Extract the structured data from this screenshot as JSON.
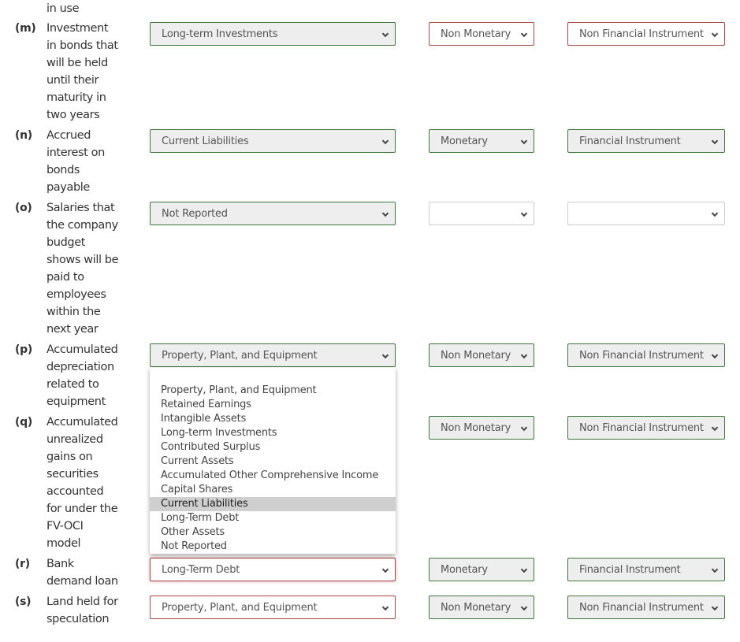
{
  "top_fragment": "in use",
  "rows": [
    {
      "letter": "(m)",
      "lines": [
        "Investment",
        "in bonds that",
        "will be held",
        "until their",
        "maturity in",
        "two years"
      ],
      "category": "Long-term Investments",
      "category_state": "correct",
      "monetary": "Non Monetary",
      "monetary_state": "incorrect",
      "financial": "Non Financial Instrument",
      "financial_state": "incorrect"
    },
    {
      "letter": "(n)",
      "lines": [
        "Accrued",
        "interest on",
        "bonds",
        "payable"
      ],
      "category": "Current Liabilities",
      "category_state": "correct",
      "monetary": "Monetary",
      "monetary_state": "correct",
      "financial": "Financial Instrument",
      "financial_state": "correct"
    },
    {
      "letter": "(o)",
      "lines": [
        "Salaries that",
        "the company",
        "budget",
        "shows will be",
        "paid to",
        "employees",
        "within the",
        "next year"
      ],
      "category": "Not Reported",
      "category_state": "correct",
      "monetary": "",
      "monetary_state": "blank",
      "financial": "",
      "financial_state": "blank"
    },
    {
      "letter": "(p)",
      "lines": [
        "Accumulated",
        "depreciation",
        "related to",
        "equipment"
      ],
      "category": "Property, Plant, and Equipment",
      "category_state": "correct",
      "monetary": "Non Monetary",
      "monetary_state": "correct",
      "financial": "Non Financial Instrument",
      "financial_state": "correct"
    },
    {
      "letter": "(q)",
      "lines": [
        "Accumulated",
        "unrealized",
        "gains on",
        "securities",
        "accounted",
        "for under the",
        "FV-OCI",
        "model"
      ],
      "category": "",
      "category_state": "hidden",
      "monetary": "Non Monetary",
      "monetary_state": "correct",
      "financial": "Non Financial Instrument",
      "financial_state": "correct"
    },
    {
      "letter": "(r)",
      "lines": [
        "Bank",
        "demand loan"
      ],
      "category": "Long-Term Debt",
      "category_state": "incorrect",
      "monetary": "Monetary",
      "monetary_state": "correct",
      "financial": "Financial Instrument",
      "financial_state": "correct"
    },
    {
      "letter": "(s)",
      "lines": [
        "Land held for",
        "speculation"
      ],
      "category": "Property, Plant, and Equipment",
      "category_state": "incorrect",
      "monetary": "Non Monetary",
      "monetary_state": "correct",
      "financial": "Non Financial Instrument",
      "financial_state": "correct"
    }
  ],
  "open_dropdown": {
    "highlighted": "Current Liabilities",
    "options": [
      "Property, Plant, and Equipment",
      "Retained Earnings",
      "Intangible Assets",
      "Long-term Investments",
      "Contributed Surplus",
      "Current Assets",
      "Accumulated Other Comprehensive Income",
      "Capital Shares",
      "Current Liabilities",
      "Long-Term Debt",
      "Other Assets",
      "Not Reported"
    ]
  },
  "colors": {
    "correct_border": "#3c763d",
    "incorrect_border": "#a94442",
    "correct_fill": "#eeeeee",
    "highlight": "#cfcfcf"
  }
}
